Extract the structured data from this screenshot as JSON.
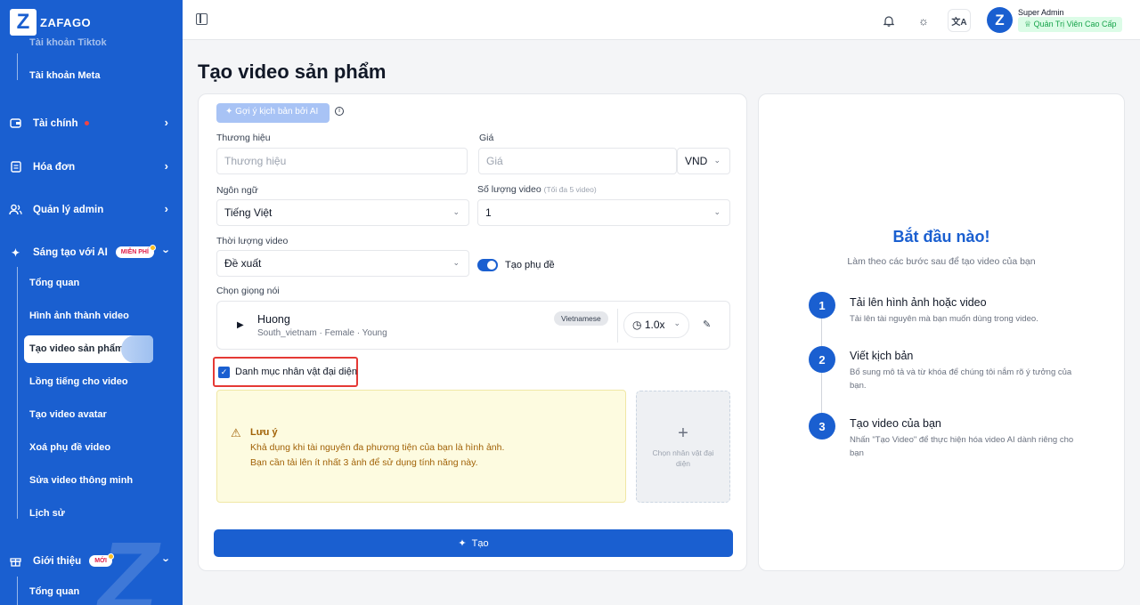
{
  "sidebar": {
    "logo": "ZAFAGO",
    "logo_tagline": "",
    "top_item": "Tài khoản Tiktok",
    "meta_item": "Tài khoản Meta",
    "nav": [
      {
        "label": "Tài chính"
      },
      {
        "label": "Hóa đơn"
      },
      {
        "label": "Quản lý admin"
      },
      {
        "label": "Sáng tạo với AI",
        "badge": "MIỄN PHÍ"
      }
    ],
    "ai_sub": [
      {
        "label": "Tổng quan"
      },
      {
        "label": "Hình ảnh thành video"
      },
      {
        "label": "Tạo video sản phẩm"
      },
      {
        "label": "Lồng tiếng cho video"
      },
      {
        "label": "Tạo video avatar"
      },
      {
        "label": "Xoá phụ đề video"
      },
      {
        "label": "Sửa video thông minh"
      },
      {
        "label": "Lịch sử"
      }
    ],
    "intro": {
      "label": "Giới thiệu",
      "badge": "MỚI"
    },
    "intro_sub": "Tổng quan"
  },
  "topbar": {
    "user_name": "Super Admin",
    "user_role": "Quản Trị Viên Cao Cấp"
  },
  "page_title": "Tạo video sản phẩm",
  "form": {
    "ai_button": "Gợi ý kịch bản bởi AI",
    "brand_label": "Thương hiệu",
    "brand_placeholder": "Thương hiệu",
    "price_label": "Giá",
    "price_placeholder": "Giá",
    "currency": "VND",
    "language_label": "Ngôn ngữ",
    "language_value": "Tiếng Việt",
    "count_label": "Số lượng video",
    "count_hint": "(Tối đa 5 video)",
    "count_value": "1",
    "duration_label": "Thời lượng video",
    "duration_value": "Đề xuất",
    "subtitle_label": "Tạo phụ đề",
    "voice_label": "Chọn giọng nói",
    "voice": {
      "name": "Huong",
      "meta": "South_vietnam · Female · Young",
      "language": "Vietnamese",
      "speed": "1.0x"
    },
    "checkbox_label": "Danh mục nhân vật đại diện",
    "note": {
      "title": "Lưu ý",
      "line1": "Khả dụng khi tài nguyên đa phương tiện của bạn là hình ảnh.",
      "line2": "Bạn cần tải lên ít nhất 3 ảnh để sử dụng tính năng này."
    },
    "upload_label": "Chọn nhân vật đại diện",
    "submit": "Tạo"
  },
  "steps": {
    "title": "Bắt đầu nào!",
    "subtitle": "Làm theo các bước sau để tạo video của bạn",
    "items": [
      {
        "num": "1",
        "title": "Tải lên hình ảnh hoặc video",
        "desc": "Tải lên tài nguyên mà bạn muốn dùng trong video."
      },
      {
        "num": "2",
        "title": "Viết kịch bản",
        "desc": "Bổ sung mô tả và từ khóa để chúng tôi nắm rõ ý tưởng của bạn."
      },
      {
        "num": "3",
        "title": "Tạo video của bạn",
        "desc": "Nhấn \"Tạo Video\" để thực hiện hóa video AI dành riêng cho bạn"
      }
    ]
  }
}
